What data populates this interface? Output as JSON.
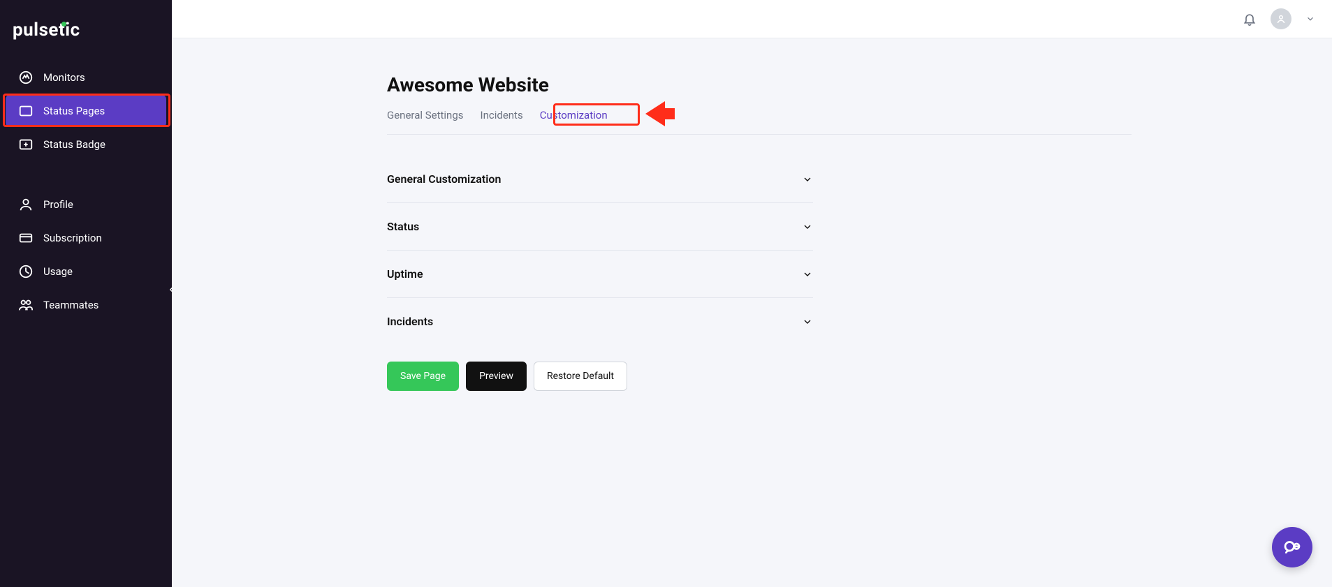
{
  "brand": "pulsetic",
  "sidebar": {
    "primary": [
      {
        "label": "Monitors",
        "icon": "monitors-icon"
      },
      {
        "label": "Status Pages",
        "icon": "status-pages-icon",
        "active": true
      },
      {
        "label": "Status Badge",
        "icon": "status-badge-icon"
      }
    ],
    "secondary": [
      {
        "label": "Profile",
        "icon": "profile-icon"
      },
      {
        "label": "Subscription",
        "icon": "subscription-icon"
      },
      {
        "label": "Usage",
        "icon": "usage-icon"
      },
      {
        "label": "Teammates",
        "icon": "teammates-icon"
      }
    ]
  },
  "page": {
    "title": "Awesome Website",
    "tabs": [
      {
        "label": "General Settings"
      },
      {
        "label": "Incidents"
      },
      {
        "label": "Customization",
        "active": true
      }
    ],
    "sections": [
      {
        "title": "General Customization"
      },
      {
        "title": "Status"
      },
      {
        "title": "Uptime"
      },
      {
        "title": "Incidents"
      }
    ],
    "buttons": {
      "save": "Save Page",
      "preview": "Preview",
      "restore": "Restore Default"
    }
  },
  "colors": {
    "accent": "#5b3cc4",
    "green": "#35c759",
    "highlight": "#ff2d1a",
    "sidebar_bg": "#1a1424"
  }
}
